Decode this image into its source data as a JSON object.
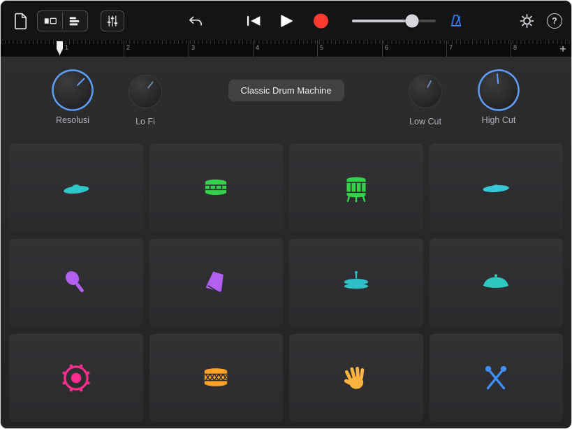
{
  "toolbar": {
    "help_label": "?",
    "record_color": "#ff3b30",
    "metronome_color": "#3a82f7",
    "volume_fill": "72%",
    "volume_knob_left": "72%"
  },
  "ruler": {
    "bars": [
      "1",
      "2",
      "3",
      "4",
      "5",
      "6",
      "7",
      "8"
    ],
    "add_label": "+"
  },
  "controls": {
    "preset_name": "Classic Drum Machine",
    "knobs": [
      {
        "label": "Resolusi",
        "ring_dash": "85 15",
        "pointer_deg": 45,
        "accent": "#5f9df5",
        "pointer_color": "#6ba0f0"
      },
      {
        "label": "Lo Fi",
        "pointer_deg": 38,
        "accent": "#5f9df5",
        "pointer_color": "#6d87ad"
      },
      {
        "label": "Low Cut",
        "pointer_deg": 28,
        "accent": "#5f9df5",
        "pointer_color": "#6d87ad"
      },
      {
        "label": "High Cut",
        "ring_dash": "100 0",
        "pointer_deg": -5,
        "accent": "#5f9df5",
        "pointer_color": "#6ba0f0"
      }
    ]
  },
  "pads": [
    {
      "instrument": "ride-cymbal",
      "color": "#2fc6c8"
    },
    {
      "instrument": "snare-drum",
      "color": "#34d14b"
    },
    {
      "instrument": "floor-tom",
      "color": "#34d14b"
    },
    {
      "instrument": "crash-cymbal",
      "color": "#36c9d9"
    },
    {
      "instrument": "maraca",
      "color": "#b25ff2"
    },
    {
      "instrument": "cowbell",
      "color": "#b25ff2"
    },
    {
      "instrument": "hi-hat-closed",
      "color": "#2fbfc6"
    },
    {
      "instrument": "hi-hat-open",
      "color": "#2fc6bc"
    },
    {
      "instrument": "kick-drum",
      "color": "#ff2d8f"
    },
    {
      "instrument": "marching-snare",
      "color": "#ffa226"
    },
    {
      "instrument": "hand-clap",
      "color": "#ffb340"
    },
    {
      "instrument": "drumsticks",
      "color": "#418dfb"
    }
  ]
}
